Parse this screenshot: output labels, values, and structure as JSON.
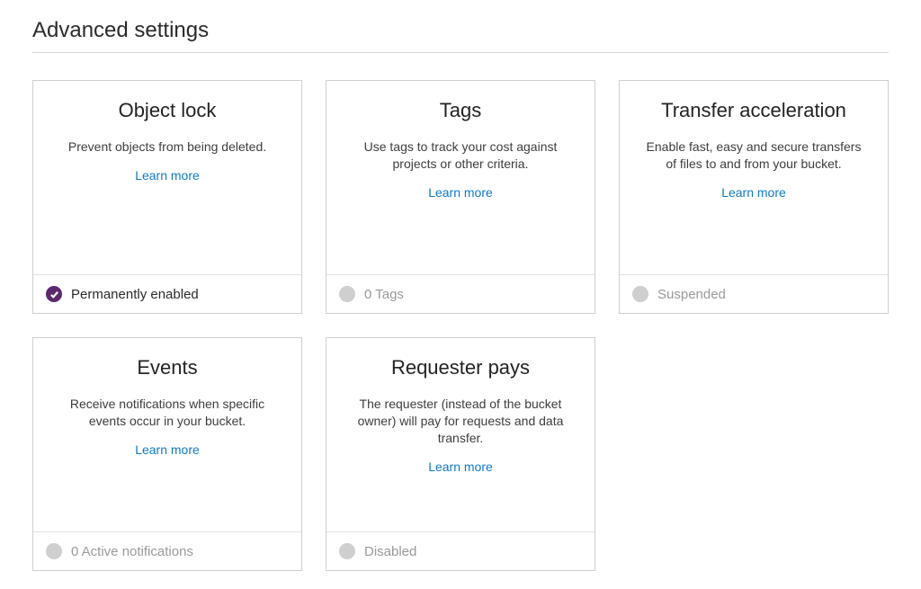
{
  "section_title": "Advanced settings",
  "learn_more_label": "Learn more",
  "cards": [
    {
      "title": "Object lock",
      "description": "Prevent objects from being deleted.",
      "status_label": "Permanently enabled",
      "status_enabled": true
    },
    {
      "title": "Tags",
      "description": "Use tags to track your cost against projects or other criteria.",
      "status_label": "0 Tags",
      "status_enabled": false
    },
    {
      "title": "Transfer acceleration",
      "description": "Enable fast, easy and secure transfers of files to and from your bucket.",
      "status_label": "Suspended",
      "status_enabled": false
    },
    {
      "title": "Events",
      "description": "Receive notifications when specific events occur in your bucket.",
      "status_label": "0 Active notifications",
      "status_enabled": false
    },
    {
      "title": "Requester pays",
      "description": "The requester (instead of the bucket owner) will pay for requests and data transfer.",
      "status_label": "Disabled",
      "status_enabled": false
    }
  ]
}
